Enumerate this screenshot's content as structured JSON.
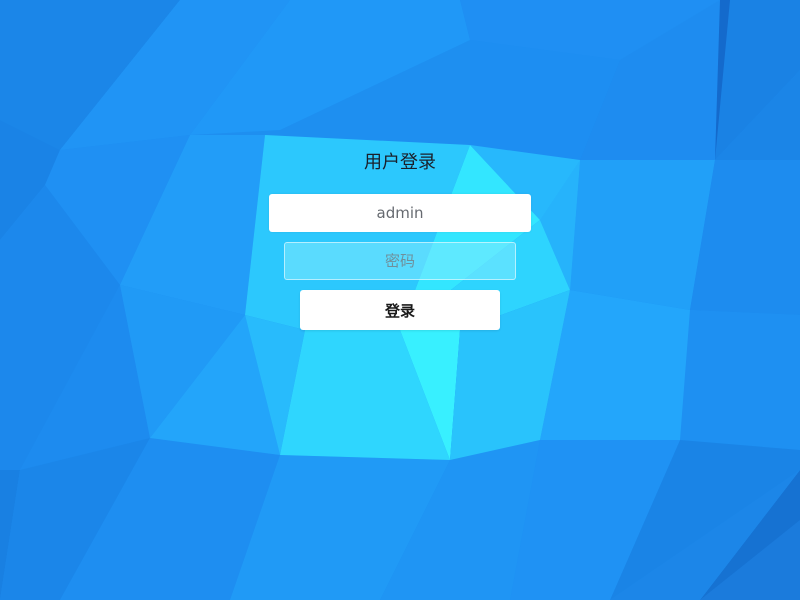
{
  "login": {
    "title": "用户登录",
    "username": {
      "value": "admin",
      "placeholder": ""
    },
    "password": {
      "value": "",
      "placeholder": "密码"
    },
    "submit_label": "登录"
  },
  "colors": {
    "background": "#1e8ff0",
    "highlight": "#35f2ff",
    "input_bg": "#ffffff"
  }
}
